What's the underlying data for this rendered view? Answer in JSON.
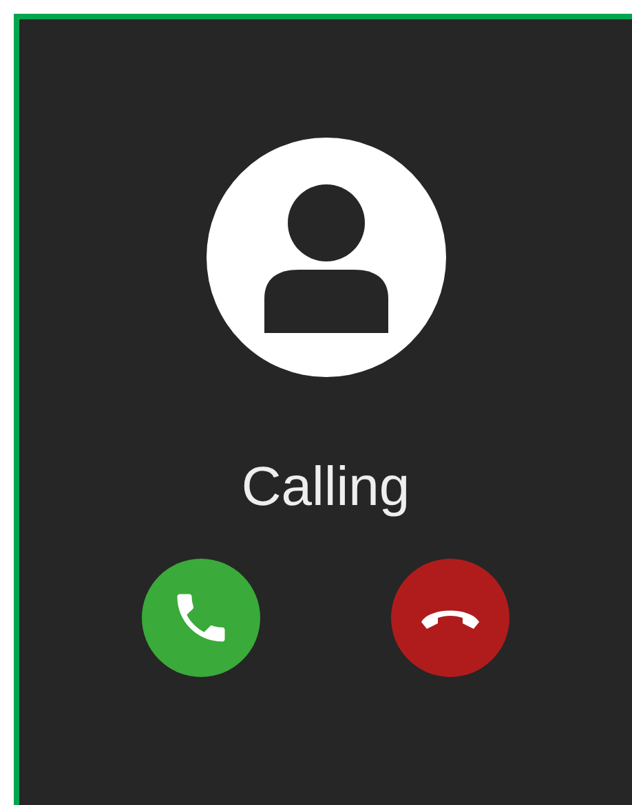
{
  "status": "Calling",
  "buttons": [
    {
      "kind": "accept"
    },
    {
      "kind": "decline"
    }
  ]
}
